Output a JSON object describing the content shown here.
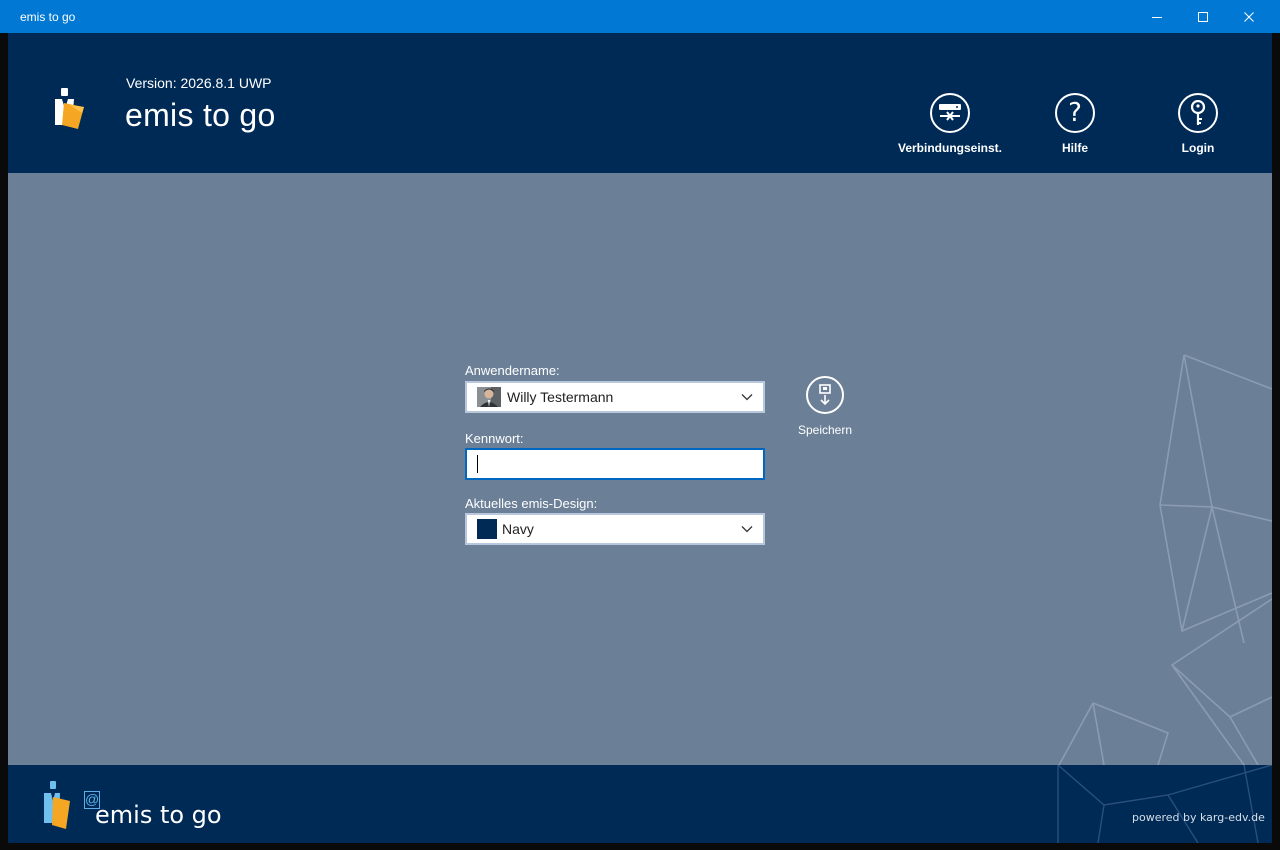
{
  "window": {
    "title": "emis to go"
  },
  "header": {
    "version": "Version: 2026.8.1 UWP",
    "app_title": "emis to go",
    "buttons": {
      "connection": "Verbindungseinst.",
      "help": "Hilfe",
      "login": "Login"
    }
  },
  "form": {
    "username_label": "Anwendername:",
    "username_value": "Willy Testermann",
    "password_label": "Kennwort:",
    "password_value": "",
    "design_label": "Aktuelles emis-Design:",
    "design_value": "Navy",
    "design_color": "#002a56",
    "save_label": "Speichern"
  },
  "footer": {
    "at_symbol": "@",
    "title": "emis to go",
    "powered": "powered by karg-edv.de"
  },
  "colors": {
    "titlebar": "#0078d4",
    "header": "#002a56",
    "main": "#6b7f97",
    "input_focus": "#0067c0"
  },
  "icons": {
    "connection": "server-disconnect-icon",
    "help": "question-icon",
    "login": "key-icon",
    "save": "save-disk-icon",
    "dropdown": "chevron-down-icon"
  }
}
